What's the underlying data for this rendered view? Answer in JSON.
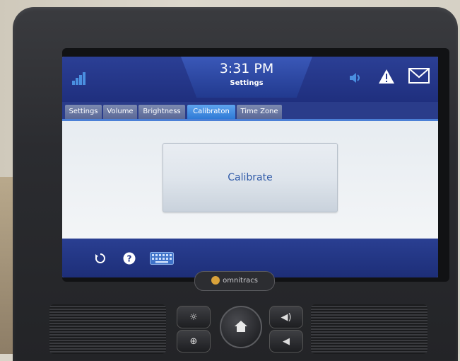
{
  "header": {
    "time": "3:31 PM",
    "subtitle": "Settings"
  },
  "tabs": [
    {
      "label": "Settings",
      "active": false
    },
    {
      "label": "Volume",
      "active": false
    },
    {
      "label": "Brightness",
      "active": false
    },
    {
      "label": "Calibraton",
      "active": true
    },
    {
      "label": "Time Zone",
      "active": false
    }
  ],
  "main": {
    "calibrate_label": "Calibrate"
  },
  "bottom_icons": [
    "refresh-icon",
    "help-icon",
    "keyboard-icon"
  ],
  "status_icons": [
    "signal-icon",
    "speaker-icon",
    "warning-icon",
    "mail-icon"
  ],
  "device": {
    "brand": "omnitracs"
  },
  "colors": {
    "header_blue": "#22358a",
    "tab_active": "#2f7ad6",
    "signal_blue": "#4a8fe0",
    "calibrate_text": "#2f5aa8"
  }
}
